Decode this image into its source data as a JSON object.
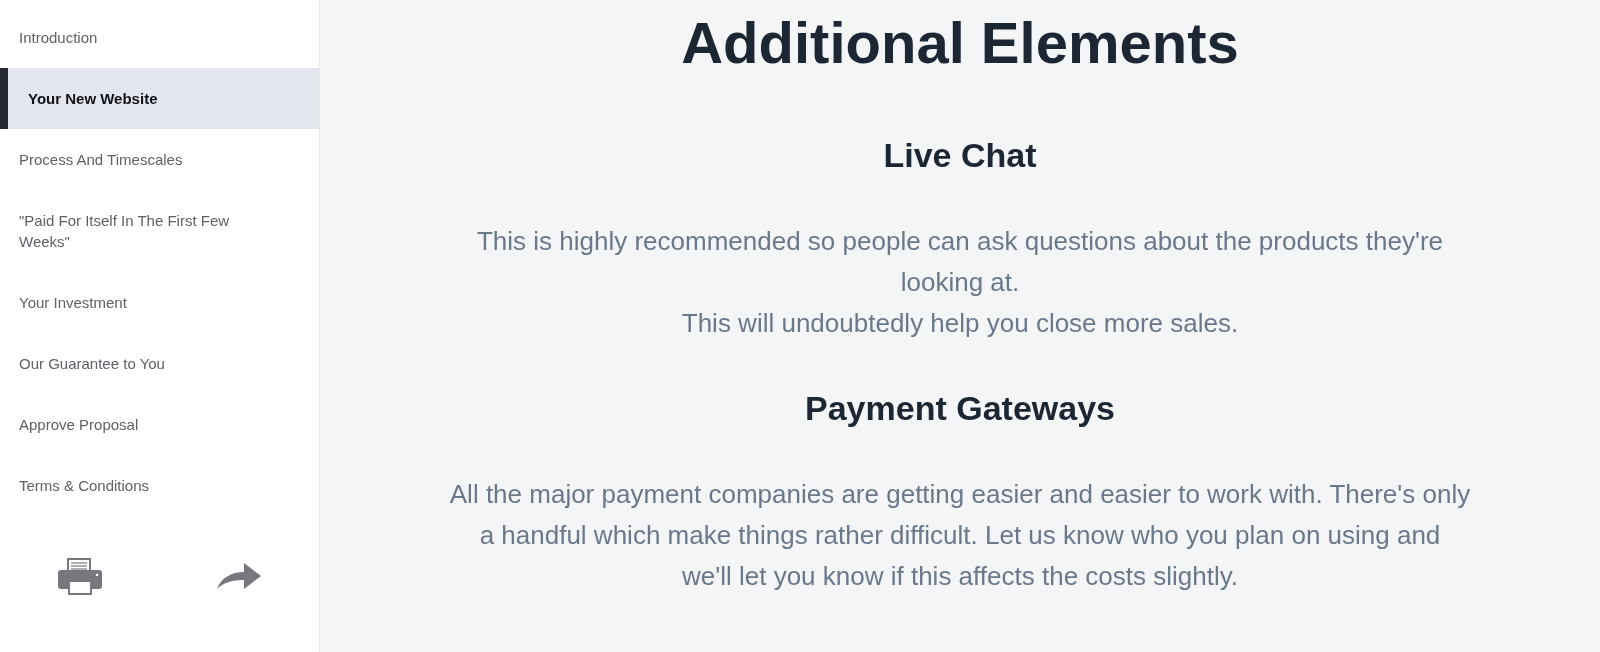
{
  "sidebar": {
    "items": [
      {
        "label": "Introduction",
        "selected": false
      },
      {
        "label": "Your New Website",
        "selected": true
      },
      {
        "label": "Process And Timescales",
        "selected": false
      },
      {
        "label": "\"Paid For Itself In The First Few Weeks\"",
        "selected": false
      },
      {
        "label": "Your Investment",
        "selected": false
      },
      {
        "label": "Our Guarantee to You",
        "selected": false
      },
      {
        "label": "Approve Proposal",
        "selected": false
      },
      {
        "label": "Terms & Conditions",
        "selected": false
      }
    ]
  },
  "main": {
    "title": "Additional Elements",
    "sections": [
      {
        "heading": "Live Chat",
        "lines": [
          "This is highly recommended so people can ask questions about the products they're",
          "looking at.",
          "This will undoubtedly help you close more sales."
        ]
      },
      {
        "heading": "Payment Gateways",
        "lines": [
          "All the major payment companies are getting easier and easier to work with. There's only",
          "a handful which make things rather difficult. Let us know who you plan on using and",
          "we'll let you know if this affects the costs slightly."
        ]
      }
    ]
  }
}
